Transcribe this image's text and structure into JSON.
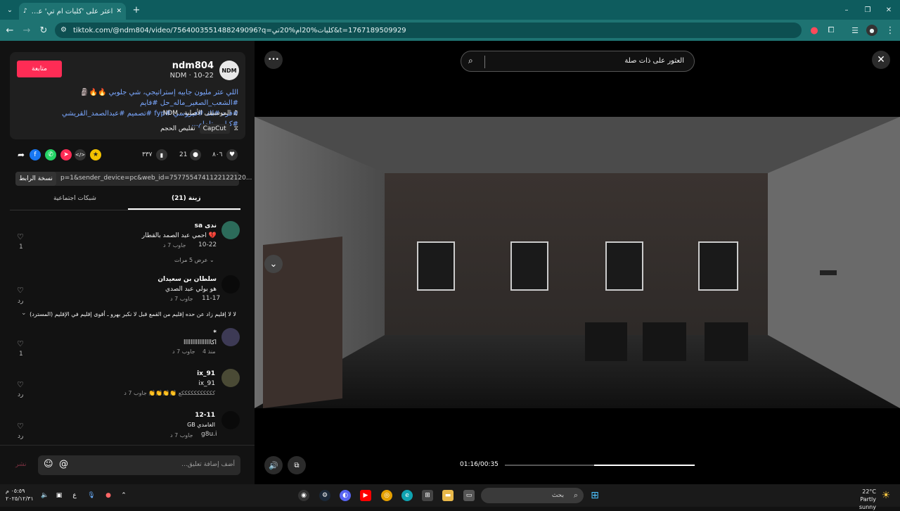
{
  "browser": {
    "tab_title": "اعثر على 'كلبات ام تي' على",
    "url": "tiktok.com/@ndm804/video/7564003551488249096?q=كلبات%20ام%20تي&t=1767189509929",
    "new_tab": "+",
    "minimize": "–",
    "restore": "❐",
    "close": "✕"
  },
  "post": {
    "follow_label": "متابعة",
    "avatar_text": "NDM",
    "username": "ndm804",
    "meta": "NDM · 10-22",
    "description_line1": "اللي عثر مليون جابيه إستراتيجي، شي جلوبي 🔥🔥🗿 #الشعب_الصغير_ماله_حل #فايم",
    "description_line2": "#فرد #لك #فيروسي #fyp #تصميم #عبدالصمد_القريشي #كيلر_بيتلمام...",
    "music": "♫ الموسيقى الأصلية - NDM",
    "capcut_label": "CapCut",
    "capcut_text": "تقليص الحجم",
    "likes": "٨٠٦",
    "comments": "21",
    "saves": "٣٣٧",
    "share_arrow": "➦",
    "embed": "</>",
    "copy_link_label": "نسخة الرابط",
    "link_text": "p=1&sender_device=pc&web_id=7577554741122122120...",
    "tab_comments": "زينة (21)",
    "tab_creator": "شبكات اجتماعية"
  },
  "comments": [
    {
      "name": "ندى sa",
      "text": "💔 احمي عبد الصمد بالقطار",
      "date": "10-22",
      "meta": "جاوب 7 د",
      "likes": "1",
      "replies": "عرض 5 مرات ⌄"
    },
    {
      "name": "سلطان بن سعيدان",
      "text": "هو بولي عبد الصدي",
      "date": "11-17",
      "meta": "جاوب 7 د",
      "likes": "رد"
    },
    {
      "name": "",
      "text": "لا لا إقليم زاد عن حده إقليم من القمع قبل لا نكبر بهرو ـ أقوى إقليم في الإقليم (المسترد)",
      "date": "",
      "meta": "",
      "likes": ""
    },
    {
      "name": "*",
      "text": "اكاااااااااااااااا",
      "date": "منذ 4",
      "meta": "جاوب 7 د",
      "likes": "1"
    },
    {
      "name": "ix_91",
      "text": "ix_91",
      "date": "",
      "meta": "كككككككككككع 👏👏👏👏 جاوب 7 د",
      "likes": "رد"
    },
    {
      "name": "12-11",
      "text": "الغامدي GB",
      "date": "g8u.i",
      "meta": "جاوب 7 د",
      "likes": "رد"
    }
  ],
  "comment_input": {
    "placeholder": "أضف إضافة تعليق...",
    "post_label": "نشر"
  },
  "video": {
    "search_text": "العثور على ذات صلة",
    "more": "•••",
    "close": "✕",
    "chevron": "⌄",
    "time": "01:16/00:35",
    "progress": 0.47
  },
  "taskbar": {
    "search_placeholder": "بحث",
    "weather_temp": "22°C",
    "weather_text": "Partly sunny",
    "clock_time": "٠٥:٥٩ م",
    "clock_date": "٢٠٢٥/١٢/٣١",
    "lang": "ع"
  },
  "colors": {
    "accent": "#fe2c55",
    "chrome": "#1e7372"
  }
}
